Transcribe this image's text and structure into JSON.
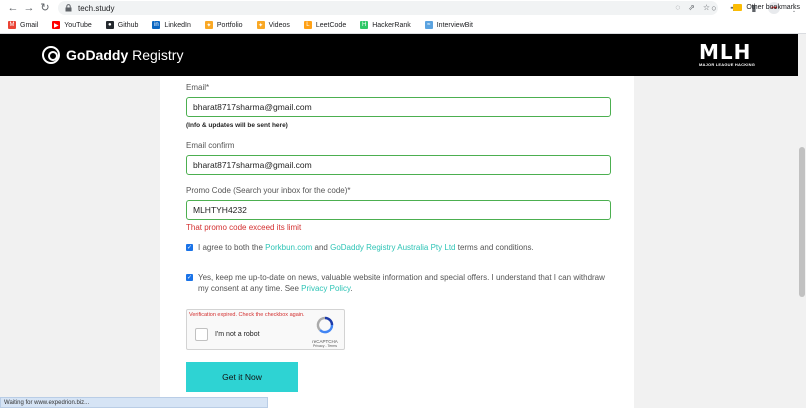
{
  "browser": {
    "url": "tech.study",
    "bookmarks": [
      {
        "label": "Gmail",
        "color": "#ea4335",
        "glyph": "M"
      },
      {
        "label": "YouTube",
        "color": "#ff0000",
        "glyph": "▶"
      },
      {
        "label": "Github",
        "color": "#24292e",
        "glyph": "●"
      },
      {
        "label": "LinkedIn",
        "color": "#0a66c2",
        "glyph": "in"
      },
      {
        "label": "Portfolio",
        "color": "#f9a825",
        "glyph": "✦"
      },
      {
        "label": "Videos",
        "color": "#f9a825",
        "glyph": "✦"
      },
      {
        "label": "LeetCode",
        "color": "#ffa116",
        "glyph": "L"
      },
      {
        "label": "HackerRank",
        "color": "#2ec866",
        "glyph": "H"
      },
      {
        "label": "InterviewBit",
        "color": "#5ba3e0",
        "glyph": "≈"
      }
    ],
    "other_bookmarks": "Other bookmarks",
    "status_text": "Waiting for www.expedrion.biz..."
  },
  "header": {
    "brand_bold": "GoDaddy",
    "brand_rest": " Registry",
    "mlh_big": "MLH",
    "mlh_small": "MAJOR LEAGUE HACKING"
  },
  "form": {
    "email_label": "Email*",
    "email_value": "bharat8717sharma@gmail.com",
    "email_note": "(Info & updates will be sent here)",
    "confirm_label": "Email confirm",
    "confirm_value": "bharat8717sharma@gmail.com",
    "promo_label": "Promo Code (Search your inbox for the code)*",
    "promo_value": "MLHTYH4232",
    "promo_error": "That promo code exceed its limit",
    "agree_prefix": "I agree to both the ",
    "agree_link1": "Porkbun.com",
    "agree_mid": " and ",
    "agree_link2": "GoDaddy Registry Australia Pty Ltd",
    "agree_suffix": " terms and conditions.",
    "updates_text": "Yes, keep me up-to-date on news, valuable website information and special offers. I understand that I can withdraw my consent at any time. See ",
    "updates_link": "Privacy Policy",
    "updates_end": ".",
    "submit_label": "Get it Now"
  },
  "recaptcha": {
    "error": "Verification expired. Check the checkbox again.",
    "label": "I'm not a robot",
    "brand": "reCAPTCHA",
    "links": "Privacy - Terms"
  }
}
